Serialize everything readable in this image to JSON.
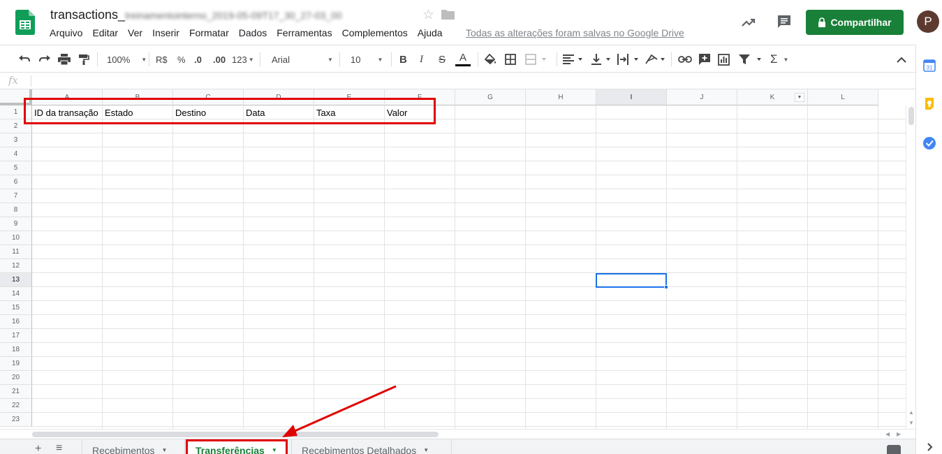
{
  "header": {
    "title": "transactions_",
    "title_blurred": "treinamentointerno_2019-05-09T17_30_27-03_00",
    "menu": [
      "Arquivo",
      "Editar",
      "Ver",
      "Inserir",
      "Formatar",
      "Dados",
      "Ferramentas",
      "Complementos",
      "Ajuda"
    ],
    "save_status": "Todas as alterações foram salvas no Google Drive",
    "share_label": "Compartilhar",
    "avatar_initial": "P"
  },
  "toolbar": {
    "zoom": "100%",
    "currency": "R$",
    "percent": "%",
    "decimal_decrease": ".0",
    "decimal_increase": ".00",
    "number_format": "123",
    "font": "Arial",
    "font_size": "10",
    "bold": "B",
    "italic": "I",
    "strike": "S",
    "text_color": "A"
  },
  "formula_bar": {
    "fx": "fx",
    "value": ""
  },
  "grid": {
    "columns": [
      "A",
      "B",
      "C",
      "D",
      "E",
      "F",
      "G",
      "H",
      "I",
      "J",
      "K",
      "L"
    ],
    "active_column": "I",
    "rows": [
      "1",
      "2",
      "3",
      "4",
      "5",
      "6",
      "7",
      "8",
      "9",
      "10",
      "11",
      "12",
      "13",
      "14",
      "15",
      "16",
      "17",
      "18",
      "19",
      "20",
      "21",
      "22",
      "23"
    ],
    "active_row": "13",
    "header_row": [
      "ID da transação",
      "Estado",
      "Destino",
      "Data",
      "Taxa",
      "Valor"
    ],
    "selected_cell": "I13"
  },
  "sheets": {
    "tabs": [
      {
        "label": "Recebimentos",
        "active": false
      },
      {
        "label": "Transferências",
        "active": true
      },
      {
        "label": "Recebimentos Detalhados",
        "active": false
      }
    ]
  },
  "side_panel": {
    "calendar_label": "31"
  },
  "colors": {
    "accent_green": "#188038",
    "selection_blue": "#1a73e8",
    "annotation_red": "#e00000",
    "sheets_green": "#0f9d58"
  }
}
